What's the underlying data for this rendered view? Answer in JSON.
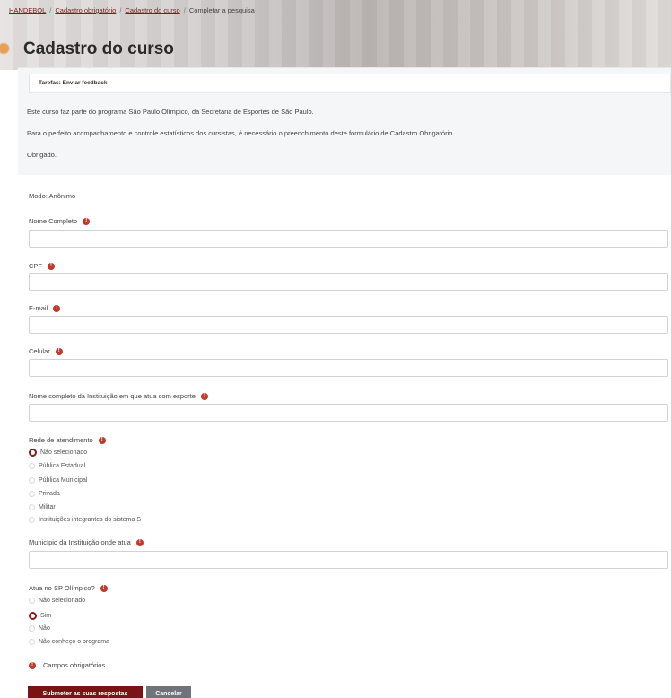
{
  "breadcrumb": {
    "items": [
      "HANDEBOL",
      "Cadastro obrigatório",
      "Cadastro do curso"
    ],
    "current": "Completar a pesquisa"
  },
  "page_title": "Cadastro do curso",
  "task": {
    "text": "Tarefas: Enviar feedback"
  },
  "intro": [
    "Este curso faz parte do programa São Paulo Olímpico, da Secretaria de Esportes de São Paulo.",
    "Para o perfeito acompanhamento e controle estatísticos dos cursistas, é necessário o preenchimento deste formulário de Cadastro Obrigatório.",
    "Obrigado."
  ],
  "mode": "Modo: Anônimo",
  "fields": {
    "nome": "Nome Completo",
    "cpf": "CPF",
    "email": "E-mail",
    "celular": "Celular",
    "instituicao": "Nome completo da Instituição em que atua com esporte",
    "municipio": "Município da Instituição onde atua"
  },
  "rede": {
    "label": "Rede de atendimento",
    "options": [
      "Não selecionado",
      "Pública Estadual",
      "Pública Municipal",
      "Privada",
      "Militar",
      "Instituições integrantes do sistema S"
    ],
    "selected": 0
  },
  "sp": {
    "label": "Atua no SP Olímpico?",
    "options": [
      "Não selecionado",
      "Sim",
      "Não",
      "Não conheço o programa"
    ],
    "selected": 1
  },
  "required_legend": "Campos obrigatórios",
  "buttons": {
    "submit": "Submeter as suas respostas",
    "cancel": "Cancelar"
  },
  "colors": {
    "accent": "#7a1313",
    "required": "#c0392b",
    "cancel": "#6e747a"
  }
}
